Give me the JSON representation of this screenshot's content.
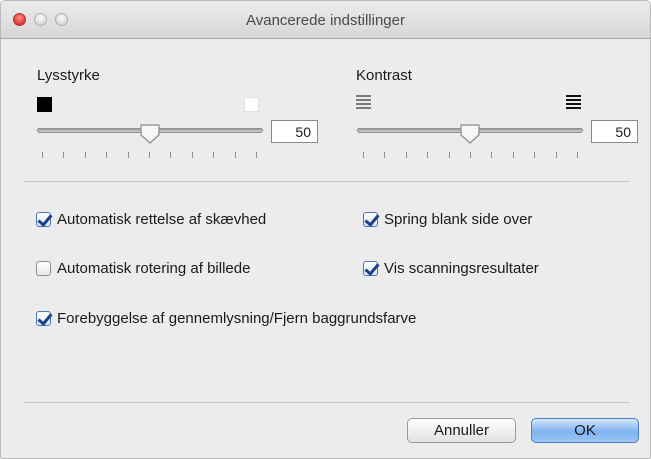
{
  "window": {
    "title": "Avancerede indstillinger"
  },
  "brightness": {
    "label": "Lysstyrke",
    "low_icon": "black-square-icon",
    "high_icon": "white-square-icon",
    "value": "50",
    "slider_fraction": 0.5
  },
  "contrast": {
    "label": "Kontrast",
    "low_icon": "low-contrast-lines-icon",
    "high_icon": "high-contrast-lines-icon",
    "value": "50",
    "slider_fraction": 0.5
  },
  "options": [
    {
      "label": "Automatisk rettelse af skævhed",
      "checked": true
    },
    {
      "label": "Spring blank side over",
      "checked": true
    },
    {
      "label": "Automatisk rotering af billede",
      "checked": false
    },
    {
      "label": "Vis scanningsresultater",
      "checked": true
    },
    {
      "label": "Forebyggelse af gennemlysning/Fjern baggrundsfarve",
      "checked": true
    }
  ],
  "buttons": {
    "cancel": "Annuller",
    "ok": "OK"
  },
  "colors": {
    "ok_button": "#7fb2ef",
    "checkmark": "#1c3f86",
    "close_button": "#e0443e"
  }
}
